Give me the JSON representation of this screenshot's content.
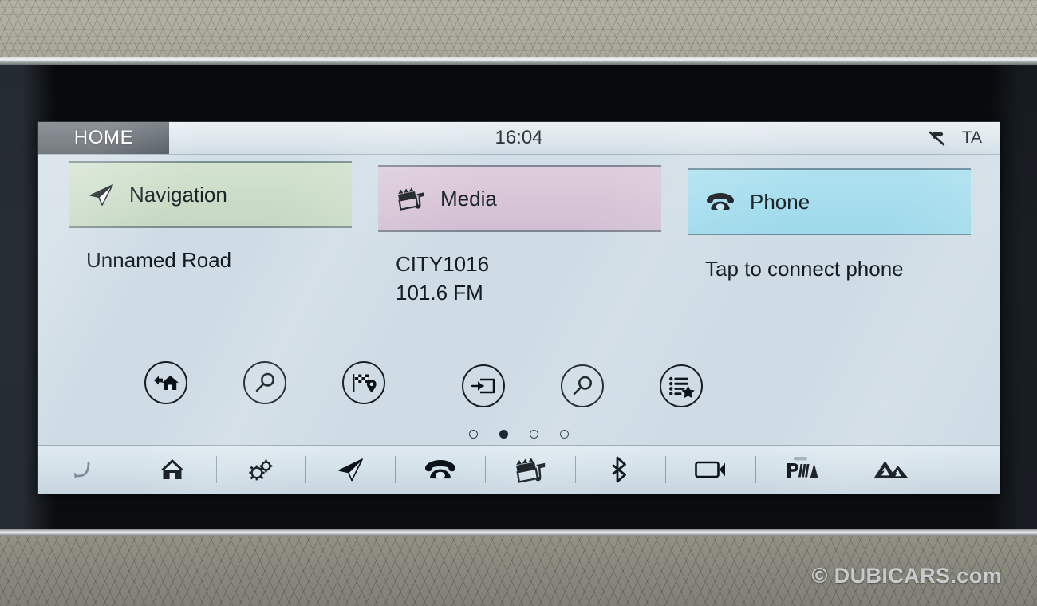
{
  "device": {
    "screen_label": "car-infotainment-display"
  },
  "statusbar": {
    "home_tab": "HOME",
    "clock": "16:04",
    "phone_disconnected_icon": "phone-crossed-out-icon",
    "ta_label": "TA"
  },
  "tiles": [
    {
      "key": "navigation",
      "label": "Navigation",
      "icon": "navigation-arrow-icon",
      "color": "#c9dcc6",
      "info_line1": "Unnamed Road",
      "info_line2": "",
      "shortcuts": [
        {
          "name": "go-home-icon",
          "label": "Go home"
        },
        {
          "name": "search-icon",
          "label": "Search destination"
        },
        {
          "name": "destination-flag-icon",
          "label": "Destinations"
        }
      ]
    },
    {
      "key": "media",
      "label": "Media",
      "icon": "media-clapper-note-icon",
      "color": "#d6c2d6",
      "info_line1": "CITY1016",
      "info_line2": "101.6 FM",
      "shortcuts": [
        {
          "name": "media-source-icon",
          "label": "Source"
        },
        {
          "name": "search-icon",
          "label": "Search media"
        },
        {
          "name": "favorites-list-icon",
          "label": "Favourites"
        }
      ]
    },
    {
      "key": "phone",
      "label": "Phone",
      "icon": "telephone-icon",
      "color": "#a3dcec",
      "info_line1": "Tap to connect phone",
      "info_line2": "",
      "shortcuts": []
    }
  ],
  "pager": {
    "total": 4,
    "active_index": 1
  },
  "toolbar": [
    {
      "name": "back-button",
      "icon": "back-arrow-icon",
      "state": "dim"
    },
    {
      "name": "home-button",
      "icon": "home-icon",
      "state": "normal"
    },
    {
      "name": "settings-button",
      "icon": "gears-icon",
      "state": "normal"
    },
    {
      "name": "navigation-button",
      "icon": "navigation-arrow-icon",
      "state": "normal"
    },
    {
      "name": "phone-button",
      "icon": "telephone-icon",
      "state": "normal"
    },
    {
      "name": "media-button",
      "icon": "media-clapper-note-icon",
      "state": "normal"
    },
    {
      "name": "bluetooth-button",
      "icon": "bluetooth-icon",
      "state": "normal"
    },
    {
      "name": "camera-button",
      "icon": "camera-display-icon",
      "state": "normal"
    },
    {
      "name": "park-assist-button",
      "icon": "park-assist-icon",
      "state": "normal"
    },
    {
      "name": "offroad-button",
      "icon": "mountains-icon",
      "state": "normal"
    }
  ],
  "watermark": "© DUBICARS.com"
}
